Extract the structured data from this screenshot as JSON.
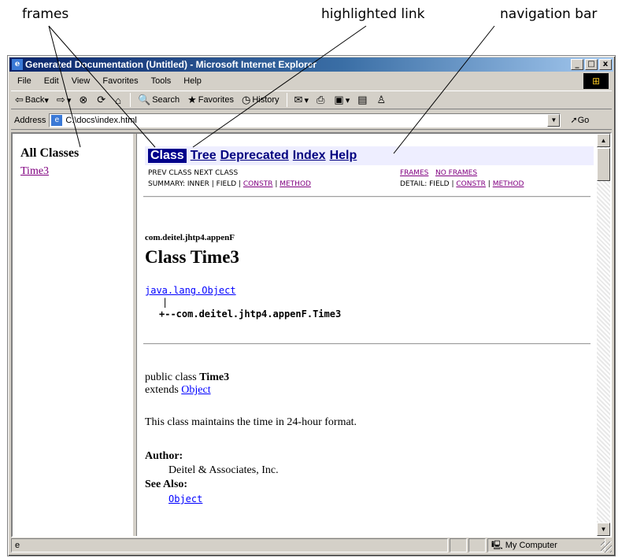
{
  "callouts": {
    "frames": "frames",
    "highlighted_link": "highlighted link",
    "navigation_bar": "navigation bar"
  },
  "window": {
    "title": "Generated Documentation (Untitled) - Microsoft Internet Explorer",
    "buttons": [
      "_",
      "□",
      "x"
    ]
  },
  "menu": [
    "File",
    "Edit",
    "View",
    "Favorites",
    "Tools",
    "Help"
  ],
  "toolbar": {
    "back": "Back",
    "search": "Search",
    "favorites": "Favorites",
    "history": "History"
  },
  "address": {
    "label": "Address",
    "value": "C:\\docs\\index.html",
    "go": "Go"
  },
  "left_frame": {
    "title": "All Classes",
    "items": [
      "Time3"
    ]
  },
  "nav": {
    "items": [
      "Class",
      "Tree",
      "Deprecated",
      "Index",
      "Help"
    ],
    "prev_next": "PREV CLASS   NEXT CLASS",
    "frames": "FRAMES",
    "no_frames": "NO FRAMES",
    "summary_prefix": "SUMMARY:  INNER | FIELD | ",
    "constr": "CONSTR",
    "method": "METHOD",
    "detail_prefix": "DETAIL:  FIELD | "
  },
  "doc": {
    "package": "com.deitel.jhtp4.appenF",
    "class_title": "Class Time3",
    "tree_root": "java.lang.Object",
    "tree_bar": "|",
    "tree_child": "+--com.deitel.jhtp4.appenF.Time3",
    "decl_prefix": "public class ",
    "decl_name": "Time3",
    "extends_prefix": "extends ",
    "extends_link": "Object",
    "description": "This class maintains the time in 24-hour format.",
    "author_label": "Author:",
    "author_value": "Deitel & Associates, Inc.",
    "see_also_label": "See Also:",
    "see_also_value": "Object"
  },
  "status": {
    "zone": "My Computer"
  }
}
